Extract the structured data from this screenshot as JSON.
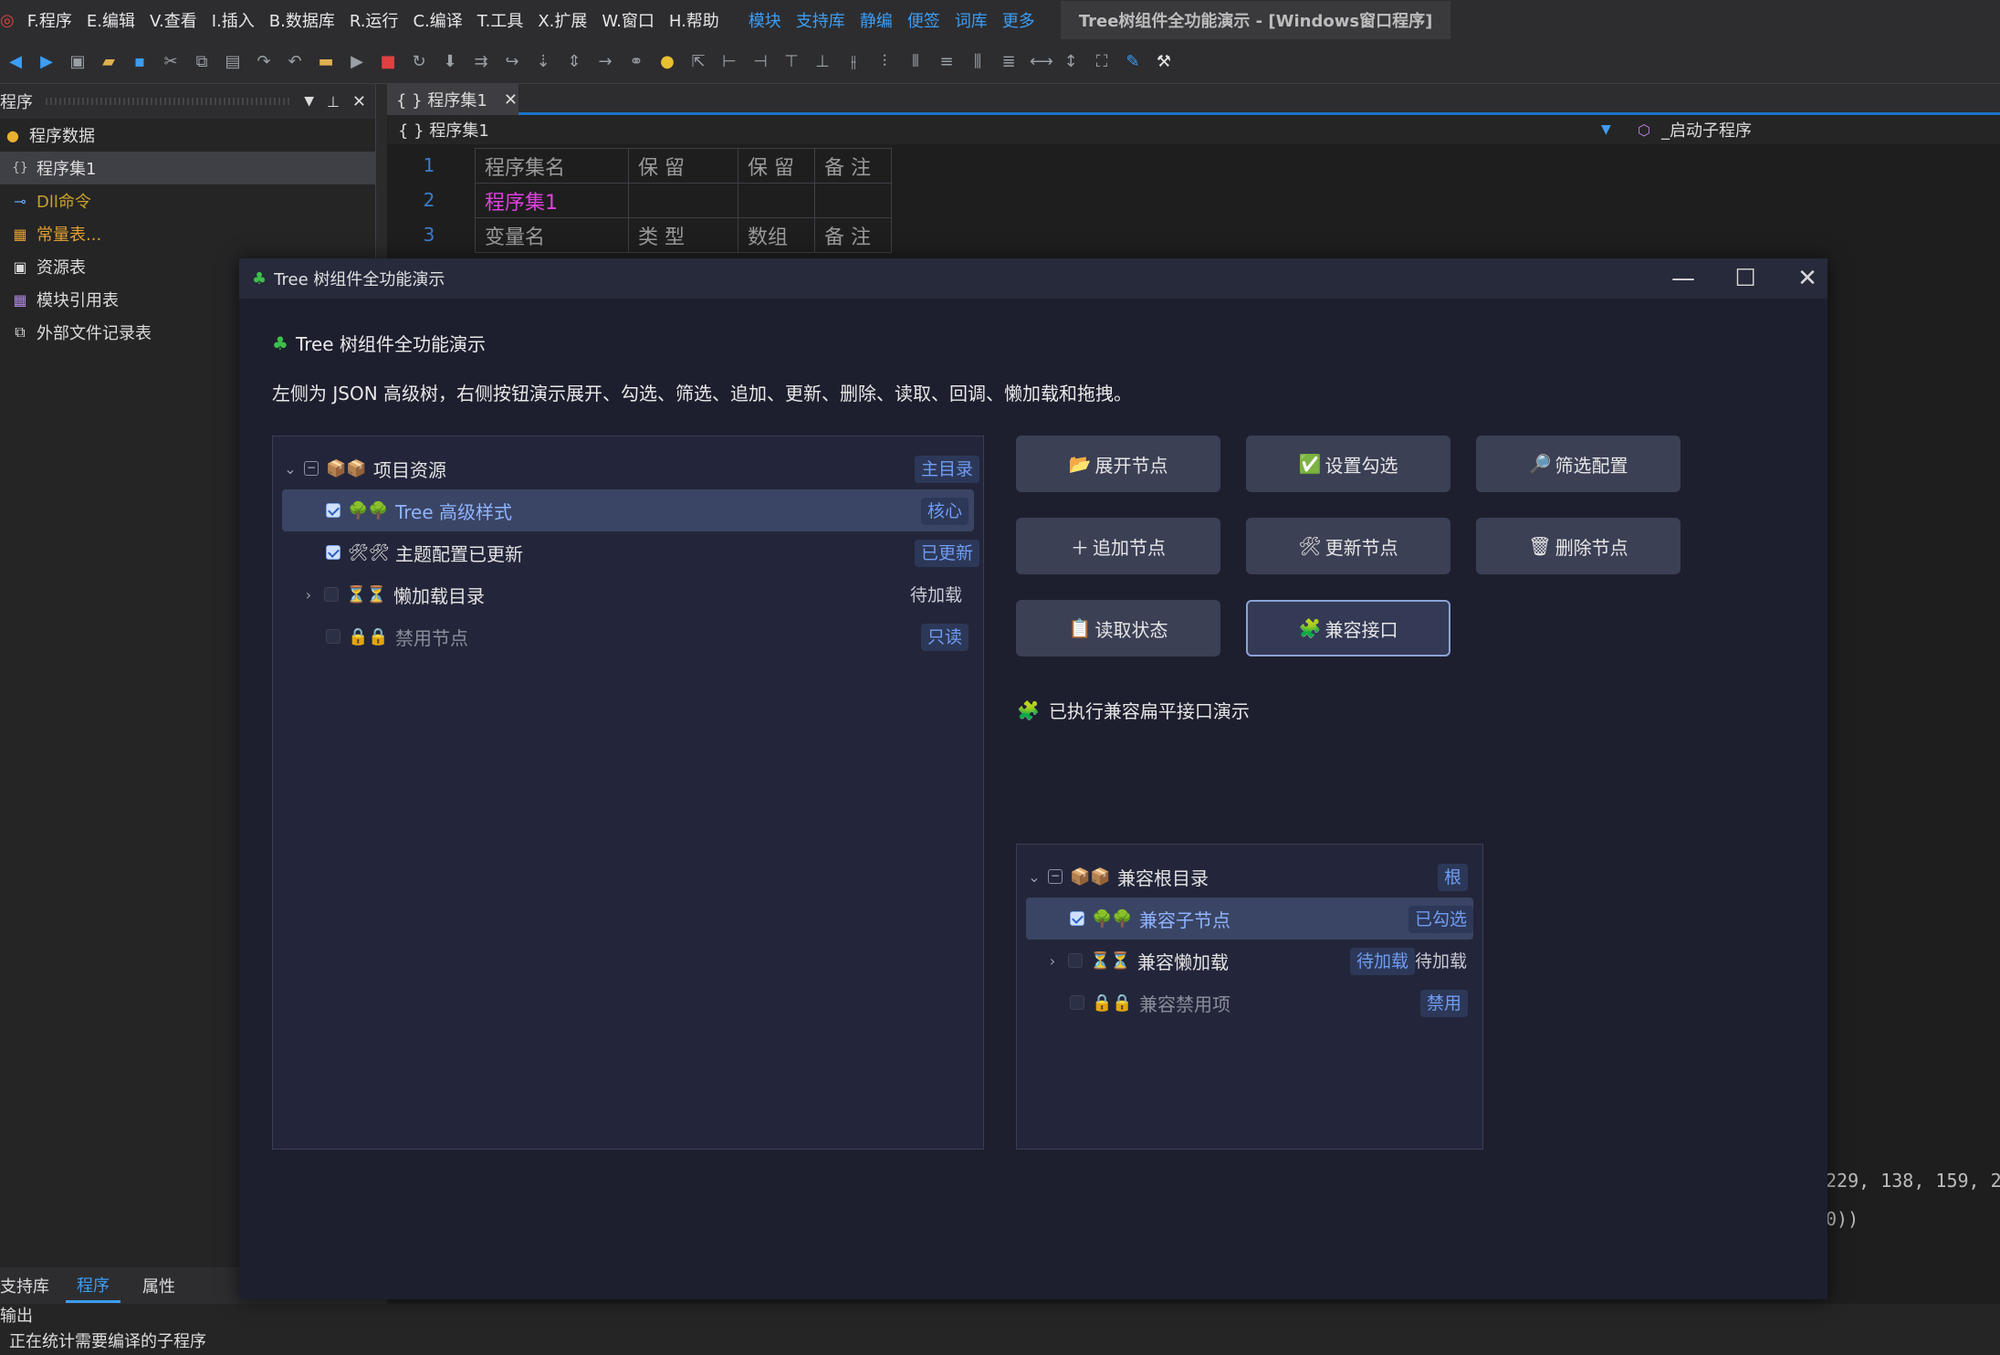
{
  "menubar": {
    "items": [
      "F.程序",
      "E.编辑",
      "V.查看",
      "I.插入",
      "B.数据库",
      "R.运行",
      "C.编译",
      "T.工具",
      "X.扩展",
      "W.窗口",
      "H.帮助"
    ],
    "blue_items": [
      "模块",
      "支持库",
      "静编",
      "便签",
      "词库",
      "更多"
    ],
    "title": "Tree树组件全功能演示 - [Windows窗口程序]"
  },
  "left_panel": {
    "header": "程序",
    "items": [
      {
        "label": "程序数据",
        "icon": "db-icon",
        "color": "#e6e6e6"
      },
      {
        "label": "程序集1",
        "icon": "braces-icon",
        "color": "#e6e6e6",
        "selected": true
      },
      {
        "label": "Dll命令",
        "icon": "link-icon",
        "color": "#c9a227"
      },
      {
        "label": "常量表...",
        "icon": "constant-icon",
        "color": "#e0a030"
      },
      {
        "label": "资源表",
        "icon": "resource-icon",
        "color": "#e6e6e6"
      },
      {
        "label": "模块引用表",
        "icon": "module-icon",
        "color": "#e6e6e6"
      },
      {
        "label": "外部文件记录表",
        "icon": "file-icon",
        "color": "#e6e6e6"
      }
    ],
    "tabs": [
      "支持库",
      "程序",
      "属性"
    ]
  },
  "bottom": {
    "title": "输出",
    "line": "正在统计需要编译的子程序"
  },
  "editor": {
    "tab": "{ } 程序集1",
    "sub_left": "{ } 程序集1",
    "sub_right": "_启动子程序",
    "rows": [
      {
        "num": "1",
        "cells": [
          "程序集名",
          "保 留",
          "保 留",
          "备 注"
        ]
      },
      {
        "num": "2",
        "cells": [
          "程序集1",
          "",
          "",
          ""
        ]
      },
      {
        "num": "3",
        "cells": [
          "变量名",
          "类 型",
          "数组",
          "备 注"
        ]
      }
    ],
    "right_code": [
      "229, 138, 159, 2",
      "0))"
    ]
  },
  "dialog": {
    "title": "Tree 树组件全功能演示",
    "heading": "Tree 树组件全功能演示",
    "description": "左侧为 JSON 高级树，右侧按钮演示展开、勾选、筛选、追加、更新、删除、读取、回调、懒加载和拖拽。",
    "buttons": [
      {
        "label": "展开节点",
        "icon": "📂"
      },
      {
        "label": "设置勾选",
        "icon": "✅"
      },
      {
        "label": "筛选配置",
        "icon": "🔎"
      },
      {
        "label": "追加节点",
        "icon": "＋"
      },
      {
        "label": "更新节点",
        "icon": "🛠"
      },
      {
        "label": "删除节点",
        "icon": "🗑"
      },
      {
        "label": "读取状态",
        "icon": "📋"
      },
      {
        "label": "兼容接口",
        "icon": "🧩"
      }
    ],
    "status": "已执行兼容扁平接口演示",
    "main_tree": [
      {
        "label": "项目资源",
        "badge": "主目录",
        "icons": "📦📦"
      },
      {
        "label": "Tree 高级样式",
        "badge": "核心",
        "icons": "🌳🌳"
      },
      {
        "label": "主题配置已更新",
        "badge": "已更新",
        "icons": "🛠🛠"
      },
      {
        "label": "懒加载目录",
        "badge": "待加载",
        "icons": "⏳⏳"
      },
      {
        "label": "禁用节点",
        "badge": "只读",
        "icons": "🔒🔒"
      }
    ],
    "compat_tree": [
      {
        "label": "兼容根目录",
        "badge": "根",
        "icons": "📦📦"
      },
      {
        "label": "兼容子节点",
        "badge": "已勾选",
        "icons": "🌳🌳"
      },
      {
        "label": "兼容懒加载",
        "badge": "待加载",
        "badge2": "待加载",
        "icons": "⏳⏳"
      },
      {
        "label": "兼容禁用项",
        "badge": "禁用",
        "icons": "🔒🔒"
      }
    ]
  }
}
